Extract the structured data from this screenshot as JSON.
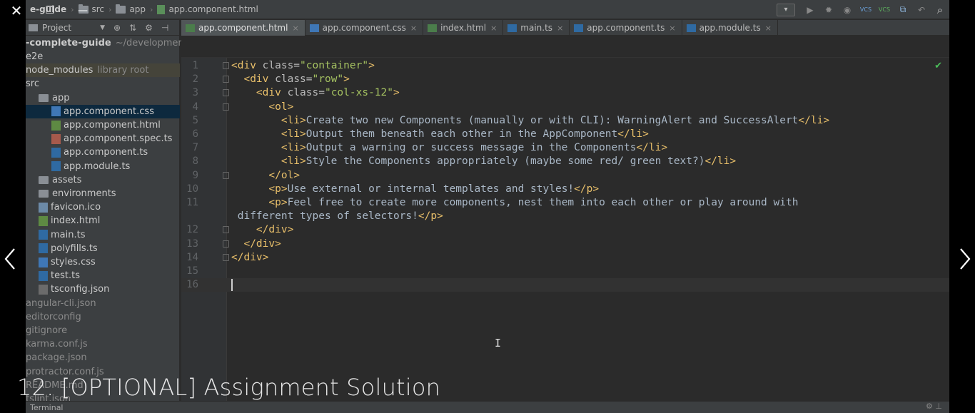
{
  "player": {
    "close_glyph": "✕",
    "restore_glyph": "❐",
    "minimize_glyph": "—",
    "overlay_title": "12. [OPTIONAL] Assignment Solution"
  },
  "breadcrumb": {
    "project": "e-guide",
    "items": [
      "src",
      "app",
      "app.component.html"
    ]
  },
  "toolbar": {
    "dropdown_glyph": "▾",
    "run_glyph": "▶",
    "debug_glyph": "✹",
    "coverage_glyph": "◉",
    "vcs_update": "VCS",
    "vcs_commit": "VCS",
    "history_glyph": "⧉",
    "undo_glyph": "↶",
    "search_glyph": "⌕"
  },
  "project_panel": {
    "header_label": "Project",
    "dropdown_glyph": "▼",
    "locate_glyph": "⊕",
    "collapse_glyph": "⇅",
    "settings_glyph": "⚙",
    "hide_glyph": "⊣"
  },
  "tree": {
    "root_name": "-complete-guide",
    "root_path": "~/development/",
    "items": [
      {
        "label": "e2e",
        "kind": "folder-plain"
      },
      {
        "label": "node_modules",
        "note": "library root",
        "kind": "folder-plain"
      },
      {
        "label": "src",
        "kind": "folder-plain"
      },
      {
        "label": "app",
        "kind": "folder"
      },
      {
        "label": "app.component.css",
        "kind": "css"
      },
      {
        "label": "app.component.html",
        "kind": "html"
      },
      {
        "label": "app.component.spec.ts",
        "kind": "spec"
      },
      {
        "label": "app.component.ts",
        "kind": "ts"
      },
      {
        "label": "app.module.ts",
        "kind": "ts"
      },
      {
        "label": "assets",
        "kind": "folder"
      },
      {
        "label": "environments",
        "kind": "folder"
      },
      {
        "label": "favicon.ico",
        "kind": "ico"
      },
      {
        "label": "index.html",
        "kind": "html"
      },
      {
        "label": "main.ts",
        "kind": "ts"
      },
      {
        "label": "polyfills.ts",
        "kind": "ts"
      },
      {
        "label": "styles.css",
        "kind": "css"
      },
      {
        "label": "test.ts",
        "kind": "ts"
      },
      {
        "label": "tsconfig.json",
        "kind": "json"
      },
      {
        "label": "angular-cli.json",
        "kind": "plain"
      },
      {
        "label": "editorconfig",
        "kind": "plain"
      },
      {
        "label": "gitignore",
        "kind": "plain"
      },
      {
        "label": "karma.conf.js",
        "kind": "plain"
      },
      {
        "label": "package.json",
        "kind": "plain"
      },
      {
        "label": "protractor.conf.js",
        "kind": "plain"
      },
      {
        "label": "README.md",
        "kind": "plain"
      },
      {
        "label": "tslint.json",
        "kind": "plain"
      }
    ]
  },
  "tabs": [
    {
      "label": "app.component.html",
      "kind": "html",
      "close": "×"
    },
    {
      "label": "app.component.css",
      "kind": "css",
      "close": "×"
    },
    {
      "label": "index.html",
      "kind": "html",
      "close": "×"
    },
    {
      "label": "main.ts",
      "kind": "ts",
      "close": "×"
    },
    {
      "label": "app.component.ts",
      "kind": "ts",
      "close": "×"
    },
    {
      "label": "app.module.ts",
      "kind": "ts",
      "close": "×"
    }
  ],
  "editor": {
    "inspection_glyph": "✔",
    "mouse_glyph": "I",
    "line_numbers": [
      "1",
      "2",
      "3",
      "4",
      "5",
      "6",
      "7",
      "8",
      "9",
      "10",
      "11",
      "",
      "12",
      "13",
      "14",
      "15",
      "16"
    ],
    "lines": [
      {
        "indent": "",
        "parts": [
          [
            "tag",
            "<div "
          ],
          [
            "attr",
            "class="
          ],
          [
            "str",
            "\"container\""
          ],
          [
            "tag",
            ">"
          ]
        ]
      },
      {
        "indent": "  ",
        "parts": [
          [
            "tag",
            "<div "
          ],
          [
            "attr",
            "class="
          ],
          [
            "str",
            "\"row\""
          ],
          [
            "tag",
            ">"
          ]
        ]
      },
      {
        "indent": "    ",
        "parts": [
          [
            "tag",
            "<div "
          ],
          [
            "attr",
            "class="
          ],
          [
            "str",
            "\"col-xs-12\""
          ],
          [
            "tag",
            ">"
          ]
        ]
      },
      {
        "indent": "      ",
        "parts": [
          [
            "tag",
            "<ol>"
          ]
        ]
      },
      {
        "indent": "        ",
        "parts": [
          [
            "tag",
            "<li>"
          ],
          [
            "txt",
            "Create two new Components (manually or with CLI): WarningAlert and SuccessAlert"
          ],
          [
            "tag",
            "</li>"
          ]
        ]
      },
      {
        "indent": "        ",
        "parts": [
          [
            "tag",
            "<li>"
          ],
          [
            "txt",
            "Output them beneath each other in the AppComponent"
          ],
          [
            "tag",
            "</li>"
          ]
        ]
      },
      {
        "indent": "        ",
        "parts": [
          [
            "tag",
            "<li>"
          ],
          [
            "txt",
            "Output a warning or success message in the Components"
          ],
          [
            "tag",
            "</li>"
          ]
        ]
      },
      {
        "indent": "        ",
        "parts": [
          [
            "tag",
            "<li>"
          ],
          [
            "txt",
            "Style the Components appropriately (maybe some red/ green text?)"
          ],
          [
            "tag",
            "</li>"
          ]
        ]
      },
      {
        "indent": "      ",
        "parts": [
          [
            "tag",
            "</ol>"
          ]
        ]
      },
      {
        "indent": "      ",
        "parts": [
          [
            "tag",
            "<p>"
          ],
          [
            "txt",
            "Use external or internal templates and styles!"
          ],
          [
            "tag",
            "</p>"
          ]
        ]
      },
      {
        "indent": "      ",
        "parts": [
          [
            "tag",
            "<p>"
          ],
          [
            "txt",
            "Feel free to create more components, nest them into each other or play around with"
          ]
        ]
      },
      {
        "indent": " ",
        "parts": [
          [
            "txt",
            "different types of selectors!"
          ],
          [
            "tag",
            "</p>"
          ]
        ]
      },
      {
        "indent": "    ",
        "parts": [
          [
            "tag",
            "</div>"
          ]
        ]
      },
      {
        "indent": "  ",
        "parts": [
          [
            "tag",
            "</div>"
          ]
        ]
      },
      {
        "indent": "",
        "parts": [
          [
            "tag",
            "</div>"
          ]
        ]
      },
      {
        "indent": "",
        "parts": []
      },
      {
        "indent": "",
        "parts": []
      }
    ]
  },
  "statusbar": {
    "terminal_label": "Terminal",
    "right_glyph": "⚙ ⊥"
  }
}
